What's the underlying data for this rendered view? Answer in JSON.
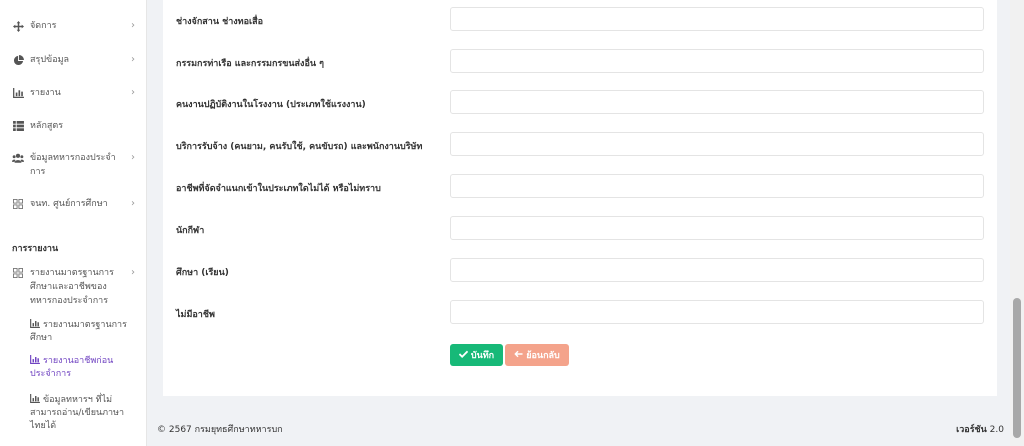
{
  "sidebar": {
    "items": [
      {
        "label": "จัดการ",
        "icon": "arrows-move-icon"
      },
      {
        "label": "สรุปข้อมูล",
        "icon": "pie-chart-icon"
      },
      {
        "label": "รายงาน",
        "icon": "bar-chart-icon"
      },
      {
        "label": "หลักสูตร",
        "icon": "table-list-icon"
      },
      {
        "label": "ข้อมูลทหารกองประจำการ",
        "icon": "users-icon"
      },
      {
        "label": "จนท. ศูนย์การศึกษา",
        "icon": "grid-icon"
      }
    ],
    "section_header": "การรายงาน",
    "report_menu": {
      "label": "รายงานมาตรฐานการศึกษาและอาชีพของทหารกองประจำการ",
      "icon": "grid-icon"
    },
    "sub_items": [
      {
        "label": "รายงานมาตรฐานการศึกษา",
        "active": false
      },
      {
        "label": "รายงานอาชีพก่อนประจำการ",
        "active": true
      },
      {
        "label": "ข้อมูลทหารฯ ที่ไม่สามารถอ่าน/เขียนภาษาไทยได้",
        "active": false
      }
    ]
  },
  "form": {
    "fields": [
      {
        "label": "ช่างจักสาน ช่างทอเสื่อ",
        "value": ""
      },
      {
        "label": "กรรมกรท่าเรือ และกรรมกรขนส่งอื่น ๆ",
        "value": ""
      },
      {
        "label": "คนงานปฏิบัติงานในโรงงาน (ประเภทใช้แรงงาน)",
        "value": ""
      },
      {
        "label": "บริการรับจ้าง (คนยาม, คนรับใช้, คนขับรถ) และพนักงานบริษัท",
        "value": ""
      },
      {
        "label": "อาชีพที่จัดจำแนกเข้าในประเภทใดไม่ได้ หรือไม่ทราบ",
        "value": ""
      },
      {
        "label": "นักกีฬา",
        "value": ""
      },
      {
        "label": "ศึกษา (เรียน)",
        "value": ""
      },
      {
        "label": "ไม่มีอาชีพ",
        "value": ""
      }
    ],
    "save_label": "บันทึก",
    "back_label": "ย้อนกลับ"
  },
  "footer": {
    "copyright": "© 2567 กรมยุทธศึกษาทหารบก",
    "version_label": "เวอร์ชัน",
    "version": "2.0"
  },
  "colors": {
    "save": "#17b978",
    "back": "#f4a38b",
    "active": "#6f42c1"
  }
}
